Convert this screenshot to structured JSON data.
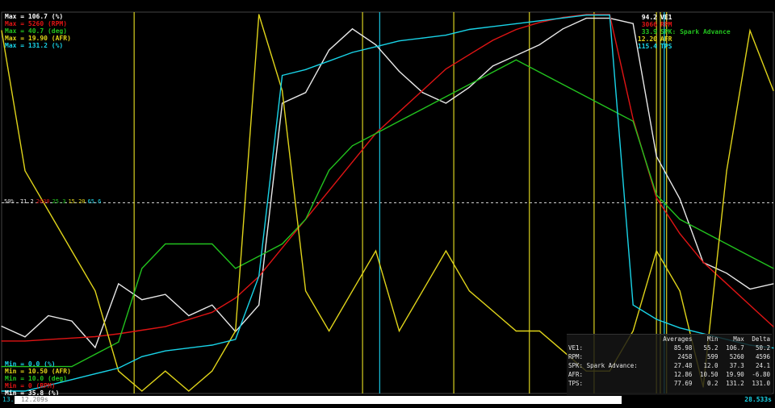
{
  "colors": {
    "ve1": "#e8e8e8",
    "rpm": "#e01414",
    "spk": "#22c21e",
    "afr": "#e0d41a",
    "tps": "#19d4e8",
    "marker_yellow": "#d8d020",
    "marker_cyan": "#19c4e0",
    "midline": "#cfcfcf"
  },
  "max_labels": [
    {
      "text": "Max = 106.7 (%)",
      "color": "#ffffff"
    },
    {
      "text": "Max = 5260 (RPM)",
      "color": "#e01414"
    },
    {
      "text": "Max = 40.7 (deg)",
      "color": "#22c21e"
    },
    {
      "text": "Max = 19.90 (AFR)",
      "color": "#e0d41a"
    },
    {
      "text": "Max = 131.2 (%)",
      "color": "#19d4e8"
    }
  ],
  "min_labels": [
    {
      "text": "Min = 0.0 (%)",
      "color": "#19d4e8"
    },
    {
      "text": "Min = 10.50 (AFR)",
      "color": "#e0d41a"
    },
    {
      "text": "Min = 10.0 (deg)",
      "color": "#22c21e"
    },
    {
      "text": "Min = 0 (RPM)",
      "color": "#e01414"
    },
    {
      "text": "Min = 35.8 (%)",
      "color": "#ffffff"
    }
  ],
  "legend": [
    {
      "value": "94.2",
      "name": "VE1",
      "color": "#ffffff"
    },
    {
      "value": "3066",
      "name": "RPM",
      "color": "#e01414"
    },
    {
      "value": "33.9",
      "name": "SPK: Spark Advance",
      "color": "#22c21e"
    },
    {
      "value": "12.20",
      "name": "AFR",
      "color": "#e0d41a"
    },
    {
      "value": "115.4",
      "name": "TPS",
      "color": "#19d4e8"
    }
  ],
  "midline": {
    "percent": "50%",
    "values": [
      {
        "text": "71.2",
        "color": "#e8e8e8"
      },
      {
        "text": "2630",
        "color": "#e01414"
      },
      {
        "text": "25.3",
        "color": "#22c21e"
      },
      {
        "text": "15.20",
        "color": "#e0d41a"
      },
      {
        "text": "65.6",
        "color": "#19d4e8"
      }
    ]
  },
  "stats": {
    "headers": [
      "",
      "Averages",
      "Min",
      "Max",
      "Delta"
    ],
    "rows": [
      {
        "name": "VE1:",
        "avg": "85.98",
        "min": "55.2",
        "max": "106.7",
        "delta": "50.2"
      },
      {
        "name": "RPM:",
        "avg": "2458",
        "min": "599",
        "max": "5260",
        "delta": "4596"
      },
      {
        "name": "SPK: Spark Advance:",
        "avg": "27.48",
        "min": "12.0",
        "max": "37.3",
        "delta": "24.1"
      },
      {
        "name": "AFR:",
        "avg": "12.86",
        "min": "10.50",
        "max": "19.90",
        "delta": "-6.80"
      },
      {
        "name": "TPS:",
        "avg": "77.69",
        "min": "0.2",
        "max": "131.2",
        "delta": "131.0"
      }
    ]
  },
  "bottom": {
    "left_number": "13.",
    "time_start": "12.209s",
    "time_end": "28.533s"
  },
  "chart_data": {
    "type": "line",
    "x": [
      0,
      3,
      6,
      9,
      12,
      15,
      18,
      21,
      24,
      27,
      30,
      33,
      36,
      39,
      42,
      45,
      48,
      51,
      54,
      57,
      60,
      63,
      66,
      69,
      72,
      75,
      78,
      81,
      84,
      87,
      90,
      93,
      96,
      99
    ],
    "xlim": [
      0,
      99
    ],
    "series": [
      {
        "name": "VE1",
        "unit": "%",
        "ymin": 35.8,
        "ymax": 106.7,
        "values": [
          48,
          46,
          50,
          49,
          44,
          56,
          53,
          54,
          50,
          52,
          47,
          52,
          90,
          92,
          100,
          104,
          101,
          96,
          92,
          90,
          93,
          97,
          99,
          101,
          104,
          106,
          106,
          105,
          80,
          72,
          60,
          58,
          55,
          56
        ]
      },
      {
        "name": "RPM",
        "unit": "RPM",
        "ymin": 0,
        "ymax": 5260,
        "values": [
          700,
          700,
          720,
          740,
          760,
          800,
          850,
          900,
          1000,
          1100,
          1300,
          1600,
          2000,
          2400,
          2800,
          3200,
          3600,
          3900,
          4200,
          4500,
          4700,
          4900,
          5050,
          5150,
          5220,
          5260,
          5260,
          3800,
          2700,
          2200,
          1800,
          1500,
          1200,
          900
        ]
      },
      {
        "name": "SPK: Spark Advance",
        "unit": "deg",
        "ymin": 10.0,
        "ymax": 40.7,
        "values": [
          12,
          12,
          12,
          12,
          13,
          14,
          20,
          22,
          22,
          22,
          20,
          21,
          22,
          24,
          28,
          30,
          31,
          32,
          33,
          34,
          35,
          36,
          37,
          36,
          35,
          34,
          33,
          32,
          26,
          24,
          23,
          22,
          21,
          20
        ]
      },
      {
        "name": "AFR",
        "unit": "AFR",
        "ymin": 10.5,
        "ymax": 19.9,
        "values": [
          19.5,
          16,
          15,
          14,
          13,
          11,
          10.5,
          11,
          10.5,
          11,
          12,
          19.9,
          18,
          13,
          12,
          13,
          14,
          12,
          13,
          14,
          13,
          12.5,
          12,
          12,
          11.5,
          11,
          11,
          12,
          14,
          13,
          10.6,
          16,
          19.5,
          18
        ]
      },
      {
        "name": "TPS",
        "unit": "%",
        "ymin": 0.0,
        "ymax": 131.2,
        "values": [
          0,
          0,
          2,
          4,
          6,
          8,
          12,
          14,
          15,
          16,
          18,
          40,
          110,
          112,
          115,
          118,
          120,
          122,
          123,
          124,
          126,
          127,
          128,
          129,
          130,
          131,
          131,
          30,
          25,
          22,
          20,
          18,
          16,
          15
        ]
      }
    ]
  }
}
